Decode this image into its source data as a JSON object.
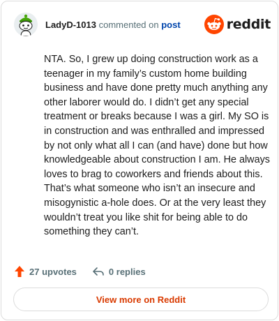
{
  "comment": {
    "username": "LadyD-1013",
    "commented_on": "commented on",
    "post_link": "post",
    "body": "NTA. So, I grew up doing construction work as a teenager in my family’s custom home building business and have done pretty much anything any other laborer would do. I didn’t get any special treatment or breaks because I was a girl. My SO is in construction and was enthralled and impressed by not only what all I can (and have) done but how knowledgeable about construction I am. He always loves to brag to coworkers and friends about this. That’s what someone who isn’t an insecure and misogynistic a-hole does. Or at the very least they wouldn’t treat you like shit for being able to do something they can’t."
  },
  "brand": {
    "name": "reddit",
    "icon": "reddit-snoo-icon",
    "color": "#ff4500"
  },
  "actions": {
    "upvotes": "27 upvotes",
    "replies": "0 replies",
    "upvote_icon": "upvote-arrow-icon",
    "reply_icon": "reply-arrow-icon",
    "upvote_color": "#ff4500"
  },
  "footer": {
    "view_more_label": "View more on Reddit"
  }
}
